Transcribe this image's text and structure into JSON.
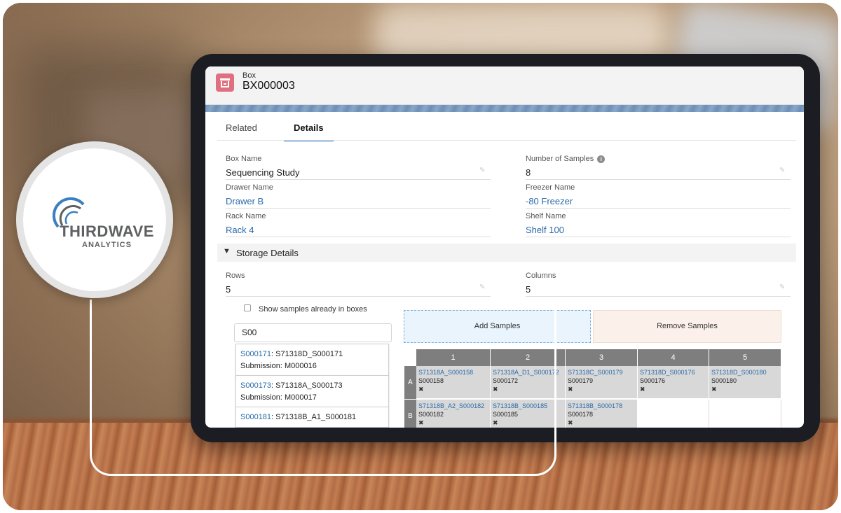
{
  "record": {
    "type": "Box",
    "name": "BX000003"
  },
  "tabs": [
    {
      "label": "Related"
    },
    {
      "label": "Details"
    }
  ],
  "details": {
    "box_name": {
      "label": "Box Name",
      "value": "Sequencing Study"
    },
    "number_of_samples": {
      "label": "Number of Samples",
      "value": "8"
    },
    "drawer_name": {
      "label": "Drawer Name",
      "value": "Drawer B"
    },
    "freezer_name": {
      "label": "Freezer Name",
      "value": "-80 Freezer"
    },
    "rack_name": {
      "label": "Rack Name",
      "value": "Rack 4"
    },
    "shelf_name": {
      "label": "Shelf Name",
      "value": "Shelf 100"
    }
  },
  "storage": {
    "section_title": "Storage Details",
    "rows": {
      "label": "Rows",
      "value": "5"
    },
    "columns": {
      "label": "Columns",
      "value": "5"
    },
    "show_in_boxes_label": "Show samples already in boxes",
    "search_value": "S00",
    "add_button": "Add Samples",
    "remove_button": "Remove Samples"
  },
  "sample_list": [
    {
      "id": "S000171",
      "rest": ": S71318D_S000171",
      "submission": "Submission: M000016"
    },
    {
      "id": "S000173",
      "rest": ": S71318A_S000173",
      "submission": "Submission: M000017"
    },
    {
      "id": "S000181",
      "rest": ": S71318B_A1_S000181",
      "submission": ""
    }
  ],
  "grid": {
    "columns": [
      "1",
      "2",
      "3",
      "4",
      "5"
    ],
    "rows": [
      {
        "label": "A",
        "cells": [
          {
            "name": "S71318A_S000158",
            "sample": "S000158",
            "remove": "✖"
          },
          {
            "name": "S71318A_D1_S000172",
            "sample": "S000172",
            "remove": "✖"
          },
          {
            "name": "S71318C_S000179",
            "sample": "S000179",
            "remove": "✖"
          },
          {
            "name": "S71318D_S000176",
            "sample": "S000176",
            "remove": "✖"
          },
          {
            "name": "S71318D_S000180",
            "sample": "S000180",
            "remove": "✖"
          }
        ]
      },
      {
        "label": "B",
        "cells": [
          {
            "name": "S71318B_A2_S000182",
            "sample": "S000182",
            "remove": "✖"
          },
          {
            "name": "S71318B_S000185",
            "sample": "S000185",
            "remove": "✖"
          },
          {
            "name": "S71318B_S000178",
            "sample": "S000178",
            "remove": "✖"
          },
          null,
          null
        ]
      }
    ]
  },
  "logo": {
    "main": "THIRDWAVE",
    "sub": "ANALYTICS"
  },
  "colors": {
    "accent": "#1b6fc0",
    "link": "#2a6baa",
    "record_icon": "#e06f7f",
    "grid_header": "#7e7e7e"
  },
  "icons": {
    "record": "box-icon",
    "edit": "pencil-icon",
    "info": "info-icon",
    "collapse": "chevron-down-icon",
    "remove": "close-icon"
  }
}
